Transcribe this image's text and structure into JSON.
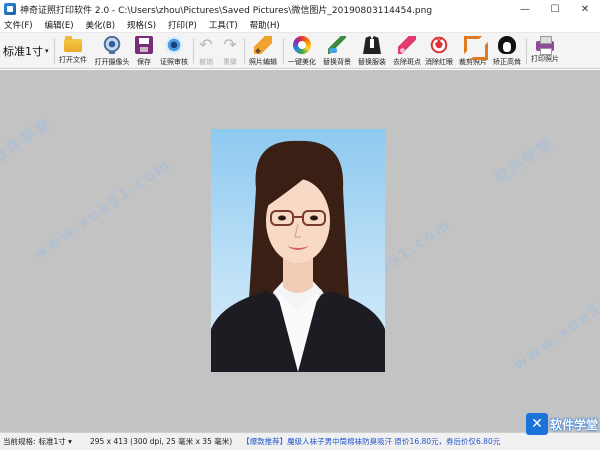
{
  "window": {
    "title": "神奇证照打印软件 2.0 - C:\\Users\\zhou\\Pictures\\Saved Pictures\\微信图片_20190803114454.png",
    "minimize": "—",
    "maximize": "☐",
    "close": "✕"
  },
  "menu": [
    {
      "label": "文件(F)"
    },
    {
      "label": "编辑(E)"
    },
    {
      "label": "美化(B)"
    },
    {
      "label": "规格(S)"
    },
    {
      "label": "打印(P)"
    },
    {
      "label": "工具(T)"
    },
    {
      "label": "帮助(H)"
    }
  ],
  "toolbar": {
    "size_select": "标准1寸",
    "size_caret": "▾",
    "buttons": {
      "open_file": "打开文件",
      "open_camera": "打开摄像头",
      "save": "保存",
      "id_check": "证照审核",
      "undo": "撤销",
      "redo": "重做",
      "photo_edit": "照片编辑",
      "one_click_beautify": "一键美化",
      "replace_background": "替换背景",
      "replace_clothes": "替换服装",
      "remove_spots": "去除斑点",
      "remove_red_eye": "消除红眼",
      "crop_photo": "裁剪照片",
      "fix_hairline": "矫正高耸",
      "print_photo": "打印照片"
    },
    "icons": {
      "open_file": "folder-icon",
      "open_camera": "webcam-icon",
      "save": "floppy-disk-icon",
      "id_check": "eye-icon",
      "undo": "undo-arrow-icon",
      "redo": "redo-arrow-icon",
      "photo_edit": "pencil-icon",
      "one_click_beautify": "color-wheel-icon",
      "replace_background": "paint-brush-icon",
      "replace_clothes": "suit-icon",
      "remove_spots": "lipstick-pen-icon",
      "remove_red_eye": "red-eye-icon",
      "crop_photo": "crop-icon",
      "fix_hairline": "hair-silhouette-icon",
      "print_photo": "printer-icon"
    }
  },
  "watermarks": [
    "软件学堂",
    "www.xue51.com"
  ],
  "status": {
    "spec_label": "当前规格:",
    "spec_value": "标准1寸 ▾",
    "dimensions": "295 x 413 (300 dpi, 25 毫米 x 35 毫米)",
    "ad": "【爆款推荐】魔级人袜子男中筒棉袜防臭吸汗  原价16.80元，券后价仅6.80元",
    "logo_text": "软件学堂"
  },
  "colors": {
    "canvas_bg": "#c3c3c3",
    "photo_bg": "#8ec9f0",
    "ad_text": "#2255cc",
    "accent": "#1a73d8"
  }
}
